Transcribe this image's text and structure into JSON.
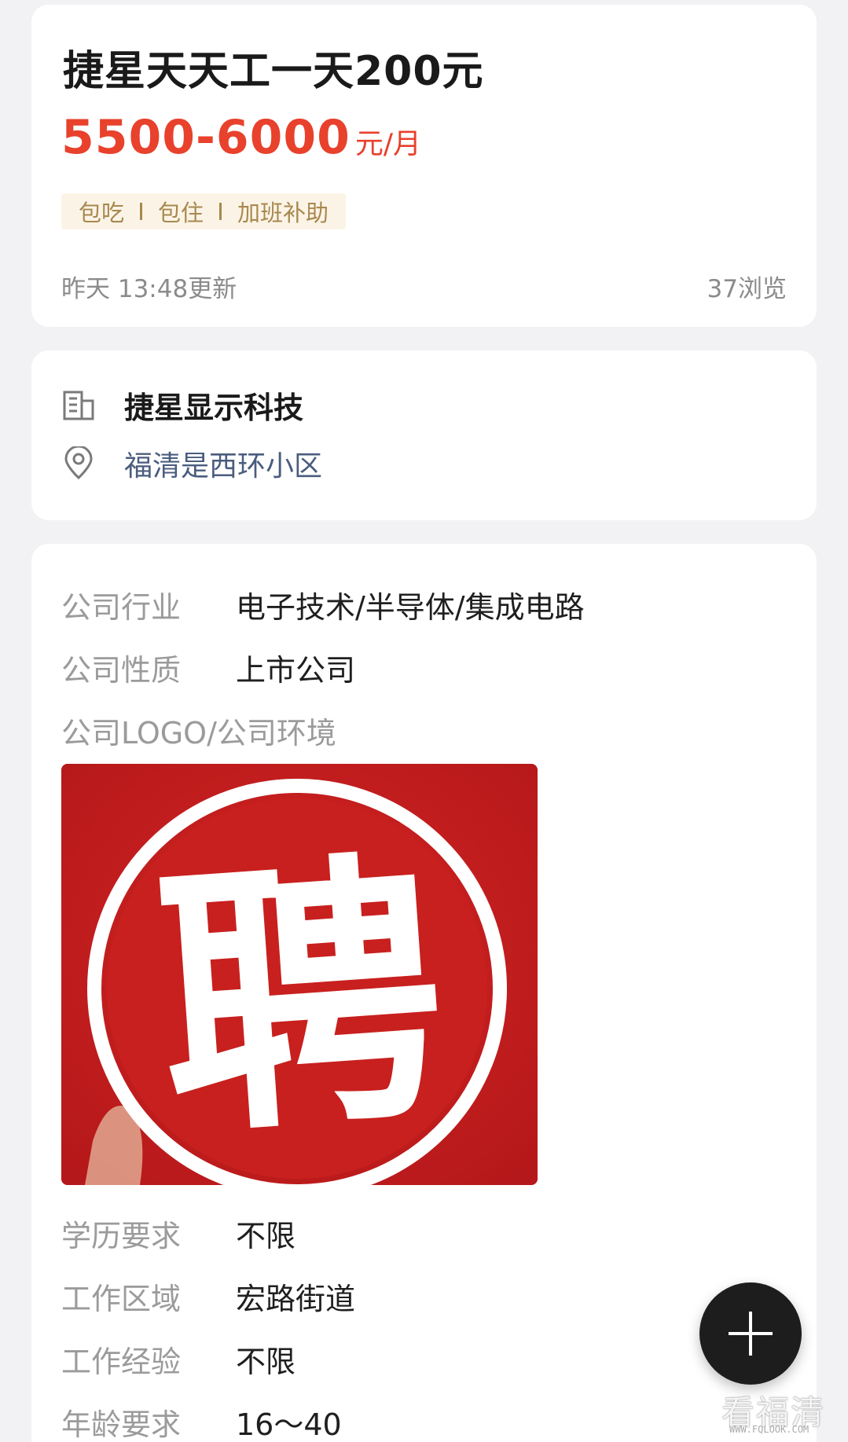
{
  "job": {
    "title": "捷星天天工一天200元",
    "salary": "5500-6000",
    "salary_unit": "元/月",
    "perks": [
      "包吃",
      "包住",
      "加班补助"
    ],
    "updated": "昨天 13:48更新",
    "views": "37浏览"
  },
  "company": {
    "name": "捷星显示科技",
    "address": "福清是西环小区"
  },
  "details": {
    "industry_label": "公司行业",
    "industry_value": "电子技术/半导体/集成电路",
    "nature_label": "公司性质",
    "nature_value": "上市公司",
    "logo_label": "公司LOGO/公司环境",
    "education_label": "学历要求",
    "education_value": "不限",
    "area_label": "工作区域",
    "area_value": "宏路街道",
    "experience_label": "工作经验",
    "experience_value": "不限",
    "age_label": "年龄要求",
    "age_value": "16～40"
  },
  "logo_image": {
    "character": "聘"
  },
  "watermark": {
    "text": "看福清",
    "site": "WWW.FQLOOK.COM"
  },
  "colors": {
    "accent_red": "#e8412c",
    "perk_gold": "#a8884f",
    "link_blue": "#4b5d7e",
    "fab_dark": "#1d1d1d"
  },
  "icons": {
    "company": "building-icon",
    "address": "location-pin-icon",
    "fab": "plus-icon"
  }
}
